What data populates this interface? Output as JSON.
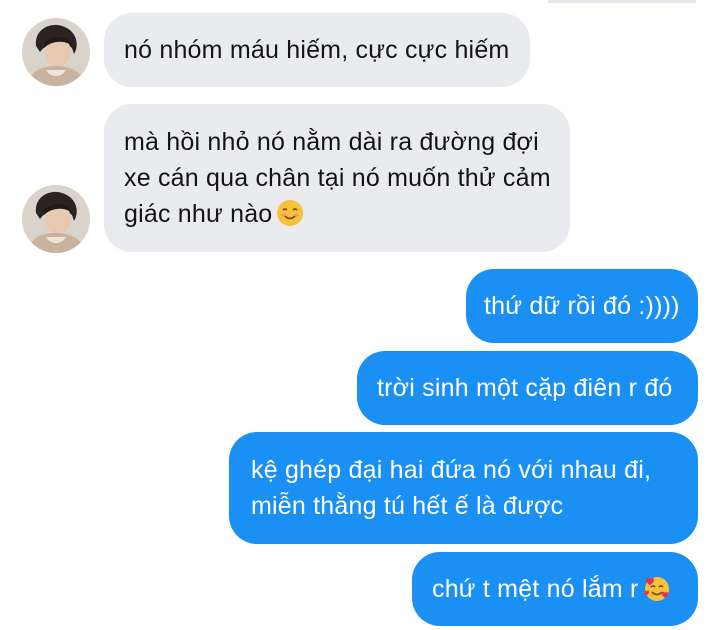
{
  "messages": {
    "m1": {
      "lines": [
        "nó nhóm máu hiếm, cực cực hiếm"
      ]
    },
    "m2": {
      "lines": [
        "mà hồi nhỏ nó nằm dài ra đường đợi",
        "xe cán qua chân tại nó muốn thử cảm",
        "giác như nào"
      ],
      "emoji": "smiling-face-icon"
    },
    "m3": {
      "lines": [
        "thứ dữ rồi đó :))))"
      ]
    },
    "m4": {
      "lines": [
        "trời sinh một cặp điên r đó"
      ]
    },
    "m5": {
      "lines": [
        "kệ ghép đại hai đứa nó với nhau đi,",
        "miễn thằng tú hết ế là được"
      ]
    },
    "m6": {
      "lines": [
        "chứ t mệt nó lắm r"
      ],
      "emoji": "smiling-face-with-hearts-icon"
    }
  },
  "colors": {
    "incoming_bubble": "#e9ebee",
    "outgoing_bubble": "#1a8ff4",
    "incoming_text": "#141414",
    "outgoing_text": "#ffffff"
  }
}
